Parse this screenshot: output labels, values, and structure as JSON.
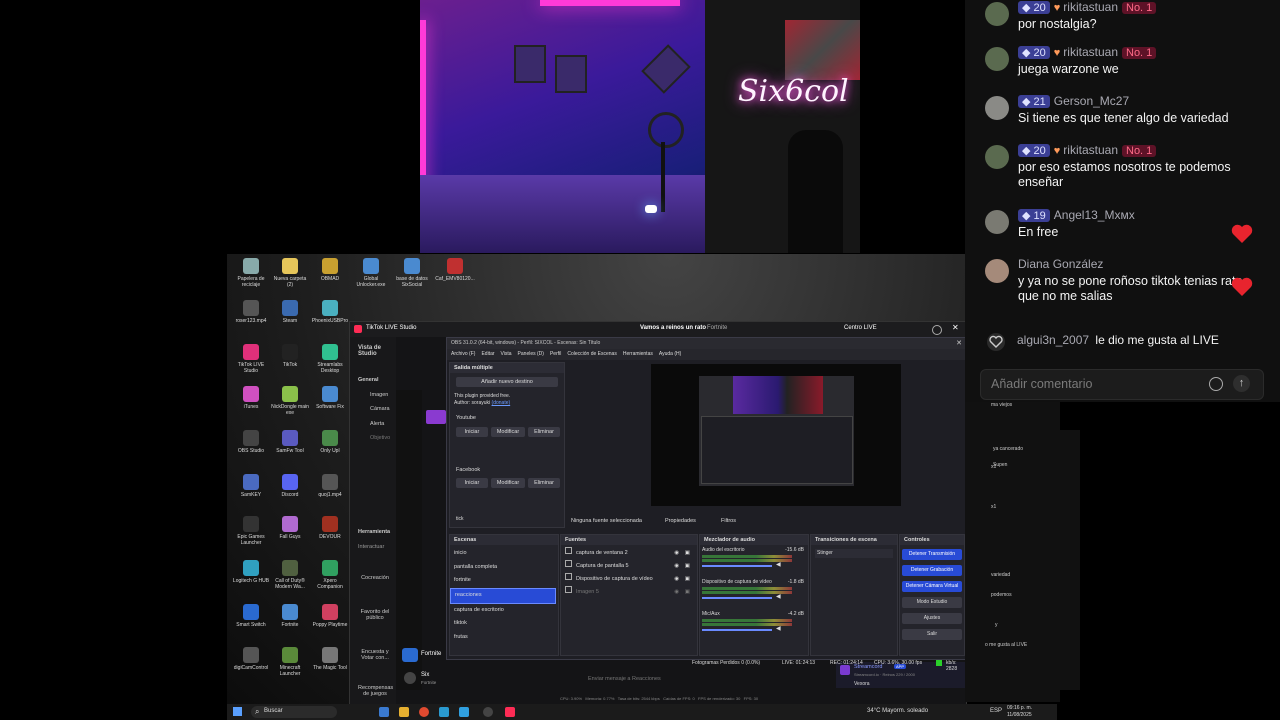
{
  "chat": {
    "messages": [
      {
        "level": "20",
        "name": "rikitastuan",
        "fan": true,
        "badge": "No. 1",
        "text": "por nostalgia?",
        "av": "#5a6a4f"
      },
      {
        "level": "20",
        "name": "rikitastuan",
        "fan": true,
        "badge": "No. 1",
        "text": "juega warzone we",
        "av": "#5a6a4f"
      },
      {
        "level": "21",
        "name": "Gerson_Mc27",
        "fan": false,
        "badge": "",
        "text": "Si tiene es que tener algo de variedad",
        "av": "#8a8a86"
      },
      {
        "level": "20",
        "name": "rikitastuan",
        "fan": true,
        "badge": "No. 1",
        "text": "por eso estamos nosotros te podemos enseñar",
        "av": "#5a6a4f"
      },
      {
        "level": "19",
        "name": "Angel13_Mxмx",
        "fan": false,
        "badge": "",
        "text": "En free",
        "av": "#7a7a72"
      },
      {
        "level": "",
        "name": "Diana González",
        "fan": false,
        "badge": "",
        "text": "y ya no se pone roñoso tiktok tenias rato que no me salias",
        "av": "#a58a7a"
      }
    ],
    "like_event": {
      "user": "algui3n_2007",
      "text": "le dio me gusta al LIVE"
    },
    "comment_placeholder": "Añadir comentario",
    "heart_color": "#e8242e"
  },
  "webcam": {
    "neon_sign": "Six6col"
  },
  "desktop": {
    "icons": [
      {
        "label": "Papelera de reciclaje",
        "color": "#8aa"
      },
      {
        "label": "Nueva carpeta (2)",
        "color": "#e6c65a"
      },
      {
        "label": "OBMAD",
        "color": "#c8a030"
      },
      {
        "label": "Global Unlocker.exe",
        "color": "#4a8ad0"
      },
      {
        "label": "base de datos SixSocial",
        "color": "#4a8ad0"
      },
      {
        "label": "Caf_EMV80120...",
        "color": "#c03030"
      },
      {
        "label": "roser123.mp4",
        "color": "#555"
      },
      {
        "label": "Steam",
        "color": "#3a6ab0"
      },
      {
        "label": "PhoenixUSBPro",
        "color": "#4ab0c0"
      },
      {
        "label": "TikTok LIVE Studio",
        "color": "#e0307a"
      },
      {
        "label": "TikTok",
        "color": "#222"
      },
      {
        "label": "Streamlabs Desktop",
        "color": "#30c090"
      },
      {
        "label": "iTunes",
        "color": "#d050c0"
      },
      {
        "label": "NickDongle main exe",
        "color": "#8ac04a"
      },
      {
        "label": "Software Fix",
        "color": "#4a8ad0"
      },
      {
        "label": "OBS Studio",
        "color": "#444"
      },
      {
        "label": "SamFw Tool",
        "color": "#5a5ac0"
      },
      {
        "label": "Only Upl",
        "color": "#4a8a4a"
      },
      {
        "label": "SamKEY",
        "color": "#4a6ac0"
      },
      {
        "label": "Discord",
        "color": "#5865f2"
      },
      {
        "label": "quoj1.mp4",
        "color": "#555"
      },
      {
        "label": "Epic Games Launcher",
        "color": "#333"
      },
      {
        "label": "Fall Guys",
        "color": "#b06ad0"
      },
      {
        "label": "DEVOUR",
        "color": "#a03020"
      },
      {
        "label": "Logitech G HUB",
        "color": "#30a0c0"
      },
      {
        "label": "Call of Duty® Modern Wa...",
        "color": "#506040"
      },
      {
        "label": "Xpero Companion",
        "color": "#30a060"
      },
      {
        "label": "Smart Switch",
        "color": "#2a6ad0"
      },
      {
        "label": "Fortnite",
        "color": "#4a8ad0"
      },
      {
        "label": "Poppy Playtime",
        "color": "#d04060"
      },
      {
        "label": "digiCamControl",
        "color": "#555"
      },
      {
        "label": "Minecraft Launcher",
        "color": "#5a8a3a"
      },
      {
        "label": "The Magic Tool",
        "color": "#777"
      }
    ]
  },
  "studio": {
    "title": "TikTok LIVE Studio",
    "live_title": "Vamos a reinos un rato",
    "game": "Fortnite",
    "centro_live": "Centro LIVE",
    "sidebar": {
      "vista": "Vista de Studio",
      "general": "General",
      "items": [
        "Imagen",
        "Cámara",
        "Alerta",
        "Objetivo"
      ],
      "herramientas": "Herramienta",
      "interactuar": "Interactuar",
      "tools": [
        "Cocreación",
        "Favorito del público",
        "Encuesta y Votar con...",
        "Recompensas de juegos"
      ]
    },
    "user": "Six",
    "user_sub": "Fortnite",
    "source_chip": "Fortnite",
    "send_placeholder": "Enviar mensaje a Reacciones",
    "streamcord": "Streamcord",
    "streamcord_sub": "Streamcord.io · Reinos 229 / 2000",
    "vexora": "Vexora",
    "app_tag": "APP"
  },
  "obs": {
    "title": "OBS 31.0.2 (64-bit, windows) - Perfil: SIXCOL - Escenas: Sin Título",
    "menu": [
      "Archivo (F)",
      "Editar",
      "Vista",
      "Paneles (D)",
      "Perfil",
      "Colección de Escenas",
      "Herramientas",
      "Ayuda (H)"
    ],
    "multi": {
      "header": "Salida múltiple",
      "add": "Añadir nuevo destino",
      "note": "This plugin provided free.",
      "author": "Author: sorayuki",
      "author_link": "(donate)",
      "targets": [
        {
          "name": "Youtube",
          "buttons": [
            "Iniciar",
            "Modificar",
            "Eliminar"
          ]
        },
        {
          "name": "Facebook",
          "buttons": [
            "Iniciar",
            "Modificar",
            "Eliminar"
          ]
        }
      ],
      "tick": "tick"
    },
    "no_source": "Ninguna fuente seleccionada",
    "props": "Propiedades",
    "filters": "Filtros",
    "scenes": {
      "header": "Escenas",
      "items": [
        "inicio",
        "pantalla completa",
        "fortnite",
        "reacciones",
        "captura de escritorio",
        "tiktok",
        "frutas"
      ],
      "selected": 3
    },
    "sources": {
      "header": "Fuentes",
      "items": [
        "captura de ventana 2",
        "Captura de pantalla 5",
        "Dispositivo de captura de vídeo",
        "Imagen 5"
      ]
    },
    "mixer": {
      "header": "Mezclador de audio",
      "channels": [
        {
          "name": "Audio del escritorio",
          "db": "-15.6 dB"
        },
        {
          "name": "Dispositivo de captura de vídeo",
          "db": "-1.8 dB"
        },
        {
          "name": "Mic/Aux",
          "db": "-4.2 dB"
        }
      ]
    },
    "transitions": {
      "header": "Transiciones de escena",
      "value": "Stinger"
    },
    "controls": {
      "header": "Controles",
      "buttons": [
        "Detener Transmisión",
        "Detener Grabación",
        "Detener Cámara Virtual",
        "Modo Estudio",
        "Ajustes",
        "Salir"
      ]
    },
    "status": {
      "dropped": "Fotogramas Perdidos 0 (0.0%)",
      "live": "LIVE: 01:24:13",
      "rec": "REC: 01:24:14",
      "cpu": "CPU: 3.6%, 30.00 fps",
      "kbs": "kb/s: 2828"
    },
    "accent": "#284bd6"
  },
  "studio_stats": {
    "cpu": "CPU: 3.90%",
    "mem": "Memoria: 0.77%",
    "bitrate": "Tasa de bits: 2544 kbps",
    "fps_drop": "Caídas de FPS: 0",
    "fps_render": "FPS de renderizado: 30",
    "fps": "FPS: 30"
  },
  "taskbar": {
    "search": "Buscar",
    "weather": "34°C  Mayorm. soleado",
    "lang": "ESP",
    "time": "09:16 p. m.",
    "date": "11/08/2025"
  },
  "right_fragments": {
    "lines": [
      "ma viejos",
      "ya cancerado",
      "Supen",
      "x1",
      "x1",
      "variedad",
      "podemos",
      "y",
      "o me gusta al LIVE"
    ]
  }
}
